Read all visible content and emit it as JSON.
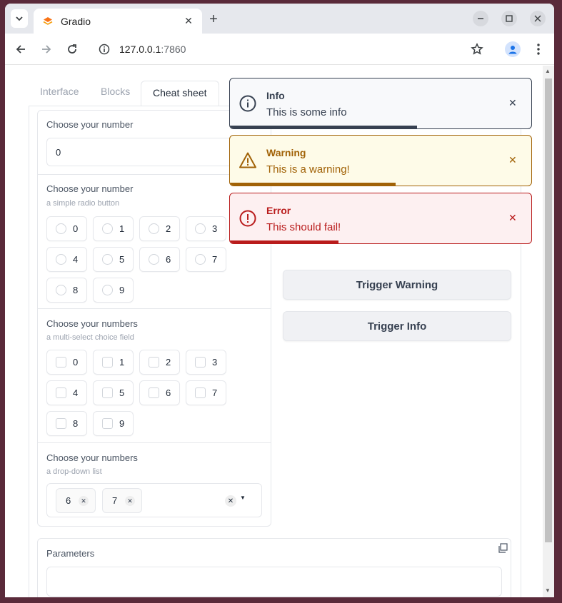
{
  "browser": {
    "tab_title": "Gradio",
    "url_host": "127.0.0.1",
    "url_port": ":7860"
  },
  "gradio": {
    "tabs": [
      {
        "label": "Interface"
      },
      {
        "label": "Blocks"
      },
      {
        "label": "Cheat sheet"
      }
    ],
    "number": {
      "label": "Choose your number",
      "value": "0"
    },
    "radio": {
      "label": "Choose your number",
      "info": "a simple radio button",
      "options": [
        "0",
        "1",
        "2",
        "3",
        "4",
        "5",
        "6",
        "7",
        "8",
        "9"
      ]
    },
    "checkboxes": {
      "label": "Choose your numbers",
      "info": "a multi-select choice field",
      "options": [
        "0",
        "1",
        "2",
        "3",
        "4",
        "5",
        "6",
        "7",
        "8",
        "9"
      ]
    },
    "dropdown": {
      "label": "Choose your numbers",
      "info": "a drop-down list",
      "selected": [
        "6",
        "7"
      ]
    },
    "buttons": {
      "trigger_warning": "Trigger Warning",
      "trigger_info": "Trigger Info"
    },
    "parameters": {
      "label": "Parameters",
      "value": ""
    }
  },
  "toasts": [
    {
      "type": "info",
      "title": "Info",
      "message": "This is some info",
      "color": "#374151",
      "progress": 0.62
    },
    {
      "type": "warning",
      "title": "Warning",
      "message": "This is a warning!",
      "color": "#a16207",
      "progress": 0.55
    },
    {
      "type": "error",
      "title": "Error",
      "message": "This should fail!",
      "color": "#b91c1c",
      "progress": 0.36
    }
  ]
}
